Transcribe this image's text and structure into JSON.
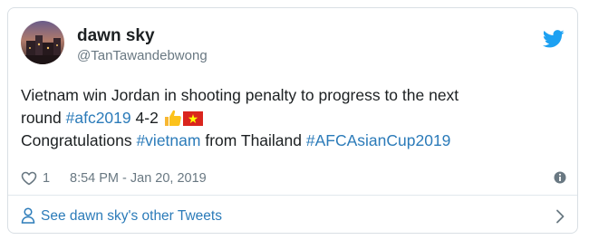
{
  "tweet": {
    "author": {
      "name": "dawn sky",
      "handle": "@TanTawandebwong"
    },
    "text": {
      "line1": "Vietnam win Jordan in shooting penalty to progress to the next",
      "line2_start": "round ",
      "hashtag_afc2019": "#afc2019",
      "score": " 4-2 ",
      "line3_start": "Congratulations ",
      "hashtag_vietnam": "#vietnam",
      "line3_mid": " from Thailand ",
      "hashtag_afcasiancup2019": "#AFCAsianCup2019"
    },
    "like_count": "1",
    "timestamp": "8:54 PM - Jan 20, 2019"
  },
  "footer": {
    "label": "See dawn sky's other Tweets"
  },
  "icons": {
    "brand": "twitter-bird-icon",
    "like": "heart-icon",
    "info": "info-icon",
    "profile": "person-icon",
    "more": "chevron-right-icon",
    "emoji_thumb": "thumbs-up-emoji",
    "emoji_flag": "vietnam-flag-emoji"
  },
  "colors": {
    "link": "#2b7bb9",
    "text": "#1c2022",
    "muted": "#697882",
    "twitter_blue": "#1da1f2",
    "border": "#d9dfe4"
  }
}
